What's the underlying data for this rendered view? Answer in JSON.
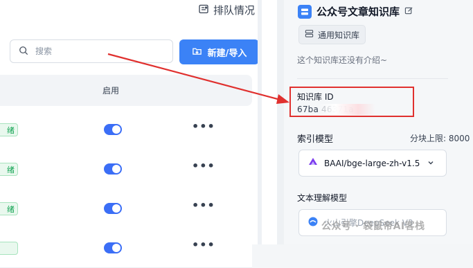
{
  "left_panel": {
    "top_action_label": "排队情况",
    "search": {
      "placeholder": "搜索",
      "value": ""
    },
    "new_button_label": "新建/导入",
    "table": {
      "enabled_header": "启用",
      "rows": [
        {
          "status": "绪",
          "enabled": true
        },
        {
          "status": "绪",
          "enabled": true
        },
        {
          "status": "绪",
          "enabled": true
        },
        {
          "status": "",
          "enabled": true
        }
      ],
      "more_label": "•••"
    }
  },
  "right_panel": {
    "title": "公众号文章知识库",
    "type_tag": "通用知识库",
    "intro": "这个知识库还没有介绍~",
    "id_label": "知识库 ID",
    "id_value": "67ba                  46371a",
    "index_model_label": "索引模型",
    "chunk_limit": "分块上限: 8000",
    "index_model_value": "BAAI/bge-large-zh-v1.5",
    "text_model_label": "文本理解模型",
    "text_model_value": "火山引擎DeepSeek V3"
  },
  "watermark": "公众号 · 袋鼠帝AI客栈",
  "colors": {
    "primary": "#3b82f6",
    "annotation_red": "#e0302e",
    "status_green": "#10a251"
  }
}
